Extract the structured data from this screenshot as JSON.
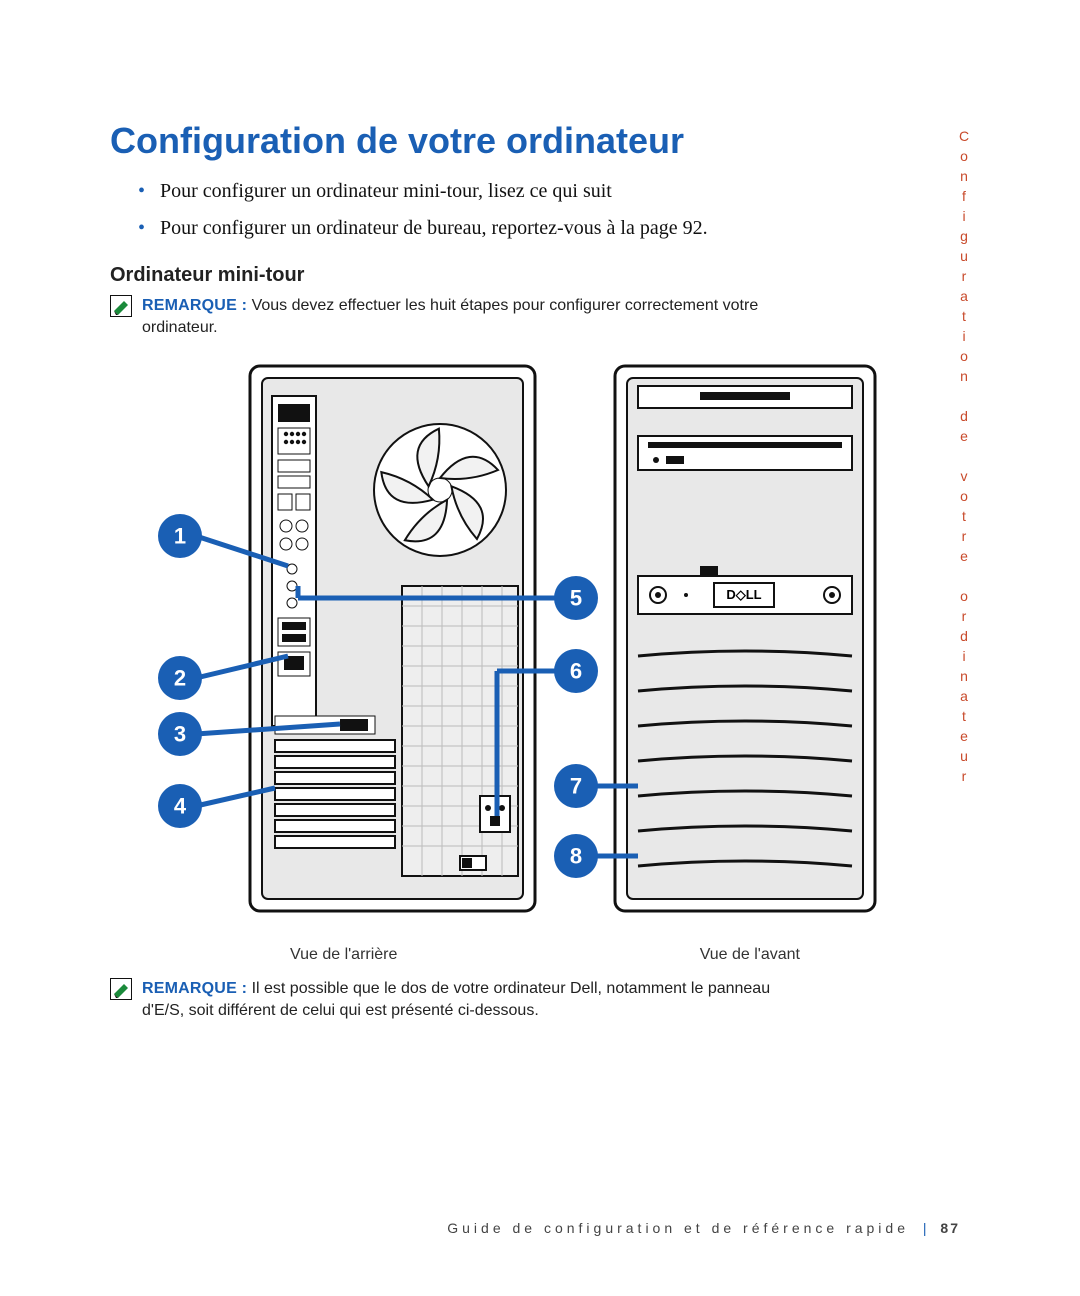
{
  "title": "Configuration de votre ordinateur",
  "bullets": [
    "Pour configurer un ordinateur mini-tour, lisez ce qui suit",
    "Pour configurer un ordinateur de bureau, reportez-vous à la page 92."
  ],
  "subheading": "Ordinateur mini-tour",
  "remark": {
    "label": "REMARQUE :",
    "text": "Vous devez effectuer les huit étapes pour configurer correctement votre ordinateur."
  },
  "diagram": {
    "callouts_left": [
      "1",
      "2",
      "3",
      "4"
    ],
    "callouts_right": [
      "5",
      "6",
      "7",
      "8"
    ],
    "caption_back": "Vue de l'arrière",
    "caption_front": "Vue de l'avant",
    "brand": "D◇LL"
  },
  "remark2": {
    "label": "REMARQUE :",
    "text": "Il est possible que le dos de votre ordinateur Dell, notamment le panneau d'E/S, soit différent de celui qui est présenté ci-dessous."
  },
  "footer": {
    "book": "Guide de configuration et de référence rapide",
    "page": "87"
  },
  "side_label": "Configuration de votre ordinateur"
}
